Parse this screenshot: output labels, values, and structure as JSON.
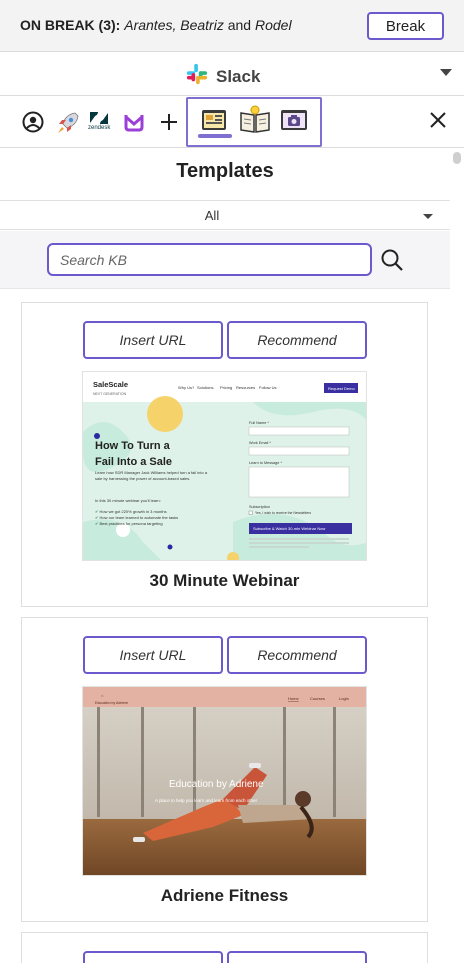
{
  "topbar": {
    "status_label": "ON BREAK (3):",
    "names_a": "Arantes, Beatriz",
    "names_and": "and",
    "names_b": "Rodel",
    "break_label": "Break"
  },
  "appbar": {
    "app_name": "Slack",
    "app_icon": "slack-logo-icon"
  },
  "iconbar": {
    "zendesk_label": "zendesk",
    "icons": [
      "user-circle-icon",
      "rocket-icon",
      "zendesk-icon",
      "uber-style-u-icon",
      "plus-icon",
      "templates-icon",
      "knowledge-book-icon",
      "screenshot-camera-icon",
      "close-icon"
    ]
  },
  "panel": {
    "title": "Templates",
    "filter_value": "All",
    "search_placeholder": "Search KB"
  },
  "cards": [
    {
      "insert_label": "Insert URL",
      "recommend_label": "Recommend",
      "name": "30 Minute Webinar",
      "preview": {
        "brand": "SaleScale",
        "brand_sub": "NEXT GENERATION",
        "nav": [
          "Why Us?",
          "Solutions",
          "Pricing",
          "Resources",
          "Follow Us"
        ],
        "cta": "Request Demo",
        "headline_1": "How To Turn a",
        "headline_2": "Fail Into a Sale",
        "body": "Learn how SDR Manager Jack Williams helped turn a fail into a sale by harnessing the power of account-based sales.",
        "subhead": "In this 30 minute webinar you'll learn:",
        "bullets": [
          "How we got 220% growth in 3 months",
          "How our team learned to automate the tasks",
          "Best practices for persona targeting"
        ],
        "form_fields": [
          "Full Name *",
          "Work Email *",
          "Learn to Message *"
        ],
        "subscription_label": "Subscription",
        "checkbox_label": "Yes, I wish to receive the Newsletters",
        "submit": "Subscribe & Watch 30-min Webinar Now"
      }
    },
    {
      "insert_label": "Insert URL",
      "recommend_label": "Recommend",
      "name": "Adriene Fitness",
      "preview": {
        "brand": "Education by Adriene",
        "nav": [
          "Home",
          "Courses",
          "Login"
        ],
        "overlay_title": "Education by Adriene",
        "overlay_sub": "A place to help you learn and learn from each other"
      }
    }
  ],
  "colors": {
    "accent": "#6a5acd",
    "tab_highlight": "#7f6fd0",
    "header_bg": "#f3f3f3"
  }
}
